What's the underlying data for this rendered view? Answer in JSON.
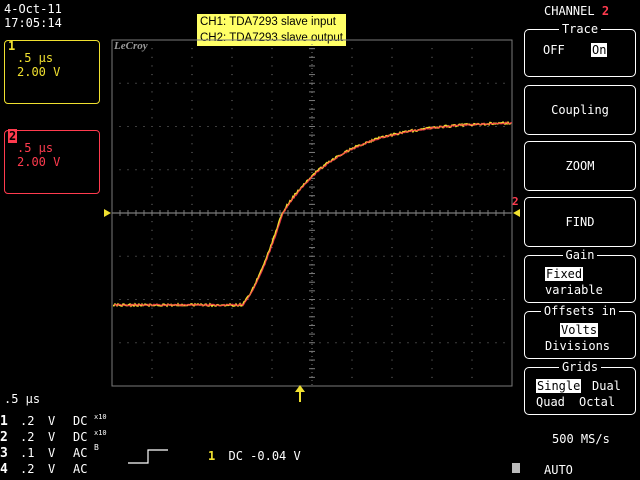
{
  "header": {
    "date": "4-Oct-11",
    "time": "17:05:14"
  },
  "channels": [
    {
      "num": "1",
      "timebase": ".5 μs",
      "volts": "2.00 V",
      "color": "#f0e030"
    },
    {
      "num": "2",
      "timebase": ".5 μs",
      "volts": "2.00 V",
      "color": "#ff3b4e"
    }
  ],
  "legend": {
    "ch1": "CH1: TDA7293 slave input",
    "ch2": "CH2: TDA7293 slave output"
  },
  "brand": "LeCroy",
  "right_menu": {
    "channel_prefix": "CHANNEL",
    "channel_number": "2",
    "trace": {
      "title": "Trace",
      "off": "OFF",
      "on": "On"
    },
    "coupling": "Coupling",
    "zoom": "ZOOM",
    "find": "FIND",
    "gain": {
      "title": "Gain",
      "fixed": "Fixed",
      "variable": "variable"
    },
    "offsets": {
      "title": "Offsets in",
      "volts": "Volts",
      "divisions": "Divisions"
    },
    "grids": {
      "title": "Grids",
      "single": "Single",
      "dual": "Dual",
      "quad": "Quad",
      "octal": "Octal"
    }
  },
  "status": {
    "timebase": ".5 μs",
    "sample_rate": "500 MS/s",
    "trigger_mode": "AUTO",
    "trigger_channel": "1",
    "trigger_info": "DC -0.04 V"
  },
  "channel_rows": [
    {
      "num": "1",
      "volts": ".2",
      "unit": "V",
      "coupling": "DC",
      "suffix": "x10"
    },
    {
      "num": "2",
      "volts": ".2",
      "unit": "V",
      "coupling": "DC",
      "suffix": "x10"
    },
    {
      "num": "3",
      "volts": ".1",
      "unit": "V",
      "coupling": "AC",
      "suffix": "B"
    },
    {
      "num": "4",
      "volts": ".2",
      "unit": "V",
      "coupling": "AC",
      "suffix": ""
    }
  ],
  "colors": {
    "grid": "#7a7a7a",
    "ch1_trace": "#f0e030",
    "ch2_trace": "#ff3b4e",
    "trigger": "#f0e030"
  }
}
